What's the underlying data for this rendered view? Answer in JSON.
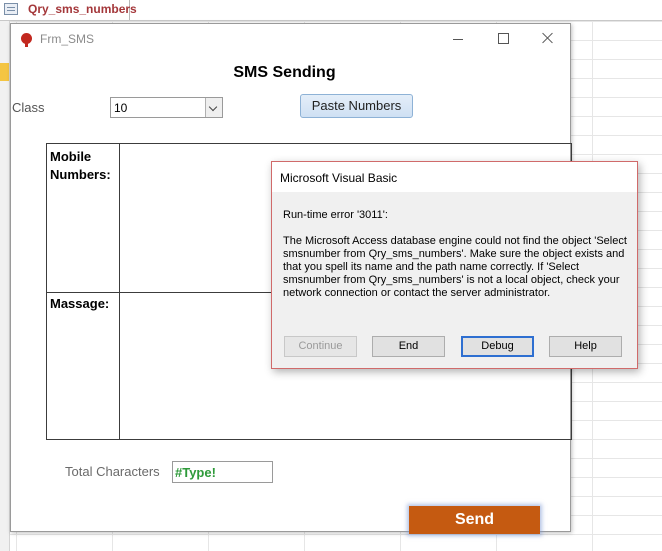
{
  "tab": {
    "label": "Qry_sms_numbers",
    "icon": "query-icon"
  },
  "form": {
    "title": "Frm_SMS",
    "heading": "SMS Sending",
    "class_label": "Class",
    "class_value": "10",
    "paste_button": "Paste Numbers",
    "mobile_label": "Mobile Numbers:",
    "massage_label": "Massage:",
    "total_label": "Total Characters",
    "total_value": "#Type!",
    "send_button": "Send"
  },
  "dialog": {
    "title": "Microsoft Visual Basic",
    "error": "Run-time error '3011':",
    "message": "The Microsoft Access database engine could not find the object 'Select smsnumber from Qry_sms_numbers'. Make sure the object exists and that you spell its name and the path name correctly. If 'Select smsnumber from Qry_sms_numbers' is not a local object, check your network connection or contact the server administrator.",
    "buttons": {
      "continue": "Continue",
      "end": "End",
      "debug": "Debug",
      "help": "Help"
    }
  },
  "colors": {
    "send": "#c55a11",
    "tab_text": "#a4373a",
    "error_value": "#2e9a3a",
    "dialog_border": "#d06a6a"
  }
}
